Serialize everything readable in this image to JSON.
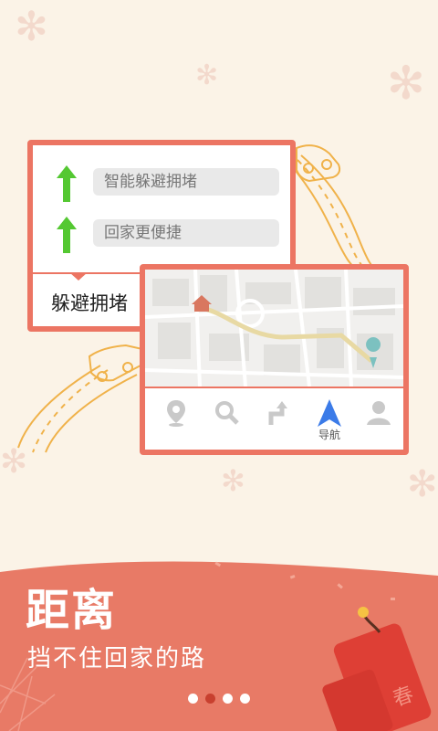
{
  "colors": {
    "background": "#fbf3e7",
    "card_border": "#ec7563",
    "banner": "#e87a66",
    "arrow_green": "#54c832",
    "nav_active": "#3b7be8",
    "dot_active": "#c8402f"
  },
  "tips_card": {
    "options": [
      {
        "label": "智能躲避拥堵",
        "icon": "up-arrow-icon"
      },
      {
        "label": "回家更便捷",
        "icon": "up-arrow-icon"
      }
    ],
    "footer_label": "躲避拥堵"
  },
  "map_card": {
    "nav_bar": [
      {
        "icon": "location-pin-icon",
        "label": ""
      },
      {
        "icon": "search-icon",
        "label": ""
      },
      {
        "icon": "route-turn-icon",
        "label": ""
      },
      {
        "icon": "navigation-arrow-icon",
        "label": "导航",
        "active": true
      },
      {
        "icon": "user-icon",
        "label": ""
      }
    ]
  },
  "banner": {
    "title": "距离",
    "subtitle": "挡不住回家的路"
  },
  "pagination": {
    "count": 4,
    "active_index": 1
  }
}
